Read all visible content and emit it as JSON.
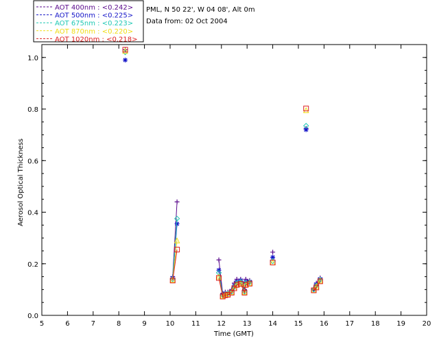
{
  "header": {
    "station": "PML, N 50 22', W 04 08', Alt 0m",
    "date_line": "Data from: 02 Oct 2004"
  },
  "chart_data": {
    "type": "line",
    "xlabel": "Time (GMT)",
    "ylabel": "Aerosol Optical Thickness",
    "xlim": [
      5,
      20
    ],
    "ylim": [
      0,
      1.05
    ],
    "x_ticks": [
      "5",
      "6",
      "7",
      "8",
      "9",
      "10",
      "11",
      "12",
      "13",
      "14",
      "15",
      "16",
      "17",
      "18",
      "19",
      "20"
    ],
    "y_ticks": [
      "0.0",
      "0.2",
      "0.4",
      "0.6",
      "0.8",
      "1.0"
    ],
    "grid": false,
    "legend_position": "top-left, outside plot",
    "series": [
      {
        "name": "AOT  400nm : <0.242>",
        "color": "#5a0a8c",
        "marker": "plus",
        "points": [
          [
            8.25,
            1.03
          ],
          [
            10.1,
            0.15
          ],
          [
            10.27,
            0.44
          ],
          [
            11.9,
            0.215
          ],
          [
            12.05,
            0.085
          ],
          [
            12.15,
            0.09
          ],
          [
            12.25,
            0.09
          ],
          [
            12.4,
            0.1
          ],
          [
            12.5,
            0.125
          ],
          [
            12.6,
            0.14
          ],
          [
            12.75,
            0.14
          ],
          [
            12.9,
            0.1
          ],
          [
            12.95,
            0.14
          ],
          [
            13.1,
            0.135
          ],
          [
            14.0,
            0.245
          ],
          [
            15.3,
            0.725
          ],
          [
            15.6,
            0.105
          ],
          [
            15.7,
            0.125
          ],
          [
            15.85,
            0.145
          ]
        ]
      },
      {
        "name": "AOT  500nm : <0.225>",
        "color": "#1414c8",
        "marker": "star",
        "points": [
          [
            8.25,
            0.99
          ],
          [
            10.1,
            0.145
          ],
          [
            10.27,
            0.355
          ],
          [
            11.9,
            0.175
          ],
          [
            12.05,
            0.08
          ],
          [
            12.15,
            0.085
          ],
          [
            12.25,
            0.085
          ],
          [
            12.4,
            0.095
          ],
          [
            12.5,
            0.115
          ],
          [
            12.6,
            0.13
          ],
          [
            12.75,
            0.135
          ],
          [
            12.9,
            0.095
          ],
          [
            12.95,
            0.13
          ],
          [
            13.1,
            0.13
          ],
          [
            14.0,
            0.225
          ],
          [
            15.3,
            0.72
          ],
          [
            15.6,
            0.1
          ],
          [
            15.7,
            0.12
          ],
          [
            15.85,
            0.14
          ]
        ]
      },
      {
        "name": "AOT  675nm : <0.223>",
        "color": "#1ec8b4",
        "marker": "diamond",
        "points": [
          [
            8.25,
            1.02
          ],
          [
            10.1,
            0.14
          ],
          [
            10.27,
            0.375
          ],
          [
            11.9,
            0.165
          ],
          [
            12.05,
            0.078
          ],
          [
            12.15,
            0.082
          ],
          [
            12.25,
            0.085
          ],
          [
            12.4,
            0.092
          ],
          [
            12.5,
            0.11
          ],
          [
            12.6,
            0.125
          ],
          [
            12.75,
            0.13
          ],
          [
            12.9,
            0.092
          ],
          [
            12.95,
            0.125
          ],
          [
            13.1,
            0.128
          ],
          [
            14.0,
            0.21
          ],
          [
            15.3,
            0.735
          ],
          [
            15.6,
            0.1
          ],
          [
            15.7,
            0.115
          ],
          [
            15.85,
            0.138
          ]
        ]
      },
      {
        "name": "AOT  870nm : <0.220>",
        "color": "#f0dc14",
        "marker": "triangle",
        "points": [
          [
            8.25,
            1.025
          ],
          [
            10.1,
            0.138
          ],
          [
            10.27,
            0.29
          ],
          [
            11.9,
            0.15
          ],
          [
            12.05,
            0.075
          ],
          [
            12.15,
            0.08
          ],
          [
            12.25,
            0.082
          ],
          [
            12.4,
            0.09
          ],
          [
            12.5,
            0.105
          ],
          [
            12.6,
            0.12
          ],
          [
            12.75,
            0.125
          ],
          [
            12.9,
            0.09
          ],
          [
            12.95,
            0.12
          ],
          [
            13.1,
            0.125
          ],
          [
            14.0,
            0.205
          ],
          [
            15.3,
            0.795
          ],
          [
            15.6,
            0.098
          ],
          [
            15.7,
            0.112
          ],
          [
            15.85,
            0.135
          ]
        ]
      },
      {
        "name": "AOT 1020nm : <0.218>",
        "color": "#dc1e1e",
        "marker": "square",
        "points": [
          [
            8.25,
            1.03
          ],
          [
            10.1,
            0.135
          ],
          [
            10.27,
            0.255
          ],
          [
            11.9,
            0.145
          ],
          [
            12.05,
            0.073
          ],
          [
            12.15,
            0.078
          ],
          [
            12.25,
            0.08
          ],
          [
            12.4,
            0.088
          ],
          [
            12.5,
            0.105
          ],
          [
            12.6,
            0.118
          ],
          [
            12.75,
            0.122
          ],
          [
            12.9,
            0.088
          ],
          [
            12.95,
            0.118
          ],
          [
            13.1,
            0.123
          ],
          [
            14.0,
            0.205
          ],
          [
            15.3,
            0.802
          ],
          [
            15.6,
            0.097
          ],
          [
            15.7,
            0.108
          ],
          [
            15.85,
            0.132
          ]
        ]
      }
    ]
  }
}
